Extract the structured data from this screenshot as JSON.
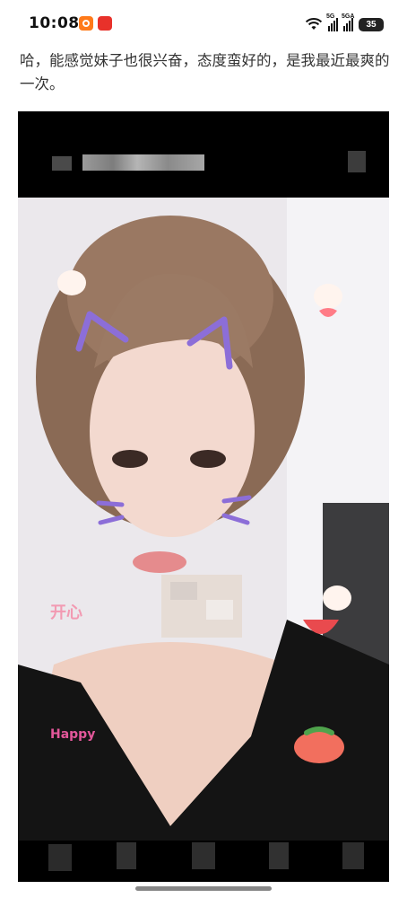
{
  "status_bar": {
    "time": "10:08",
    "network_1": "5G",
    "network_2": "5GA",
    "battery": "35"
  },
  "post": {
    "text": "哈，能感觉妹子也很兴奋，态度蛮好的，是我最近最爽的一次。"
  },
  "image": {
    "stickers": {
      "happy_text": "Happy",
      "kaixin_text": "开心"
    }
  },
  "colors": {
    "text": "#333333",
    "image_frame": "#000000",
    "home_indicator": "#888888"
  }
}
